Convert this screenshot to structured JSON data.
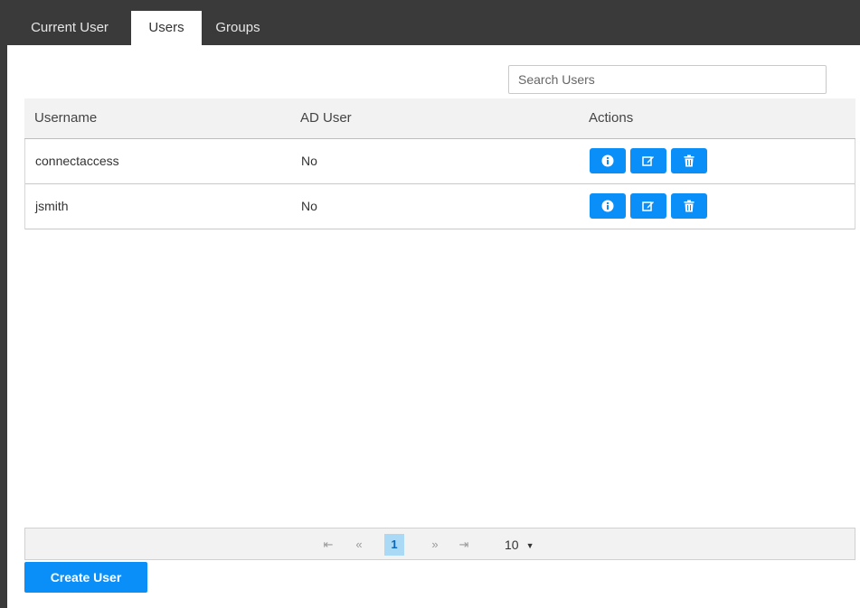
{
  "tabs": [
    {
      "label": "Current User",
      "active": false
    },
    {
      "label": "Users",
      "active": true
    },
    {
      "label": "Groups",
      "active": false
    }
  ],
  "search": {
    "placeholder": "Search Users",
    "value": ""
  },
  "table": {
    "headers": [
      "Username",
      "AD User",
      "Actions"
    ],
    "rows": [
      {
        "username": "connectaccess",
        "ad_user": "No"
      },
      {
        "username": "jsmith",
        "ad_user": "No"
      }
    ],
    "action_icons": [
      "info-icon",
      "edit-icon",
      "trash-icon"
    ]
  },
  "pagination": {
    "first_glyph": "⇤",
    "prev_glyph": "«",
    "current_page": "1",
    "next_glyph": "»",
    "last_glyph": "⇥",
    "page_size": "10",
    "page_size_caret": "▼"
  },
  "create_button": {
    "label": "Create User"
  },
  "colors": {
    "accent": "#0a8ef7",
    "tabbar": "#3a3a3a",
    "page_highlight": "#a9d9f5"
  }
}
